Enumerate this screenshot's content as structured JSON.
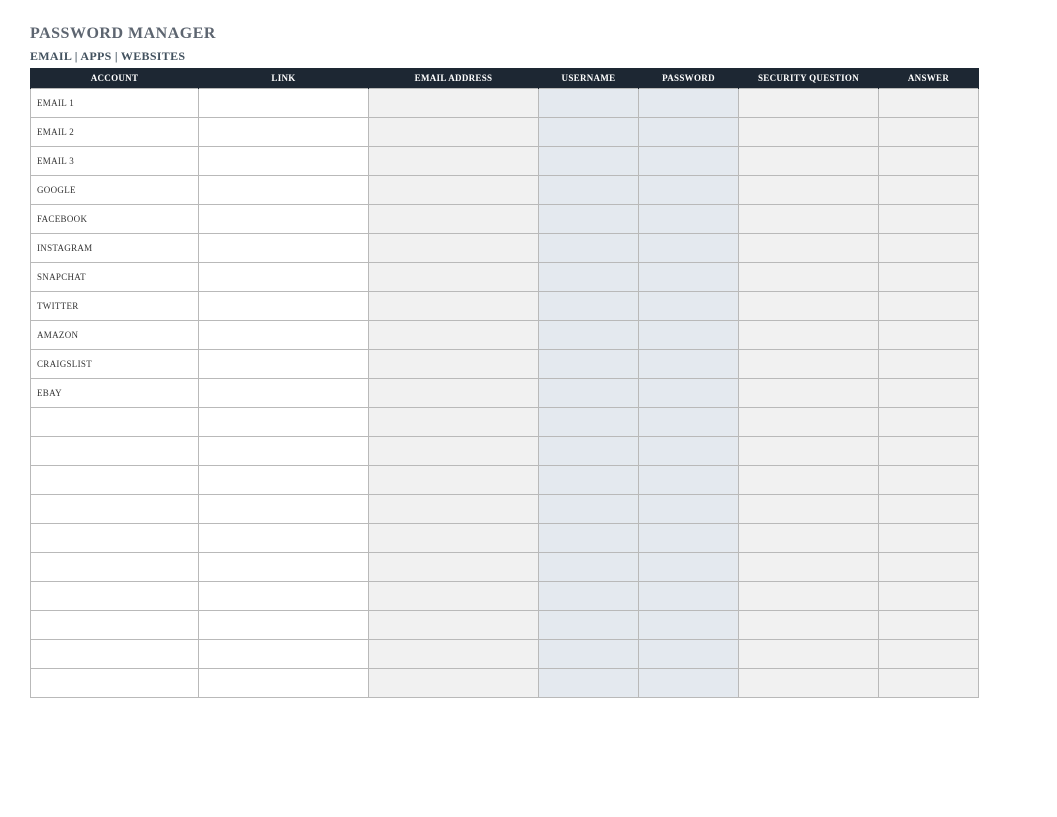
{
  "title": "PASSWORD MANAGER",
  "subtitle": "EMAIL | APPS | WEBSITES",
  "columns": {
    "account": "ACCOUNT",
    "link": "LINK",
    "email": "EMAIL ADDRESS",
    "username": "USERNAME",
    "password": "PASSWORD",
    "secq": "SECURITY QUESTION",
    "answer": "ANSWER"
  },
  "rows": [
    {
      "account": "EMAIL 1",
      "link": "",
      "email": "",
      "username": "",
      "password": "",
      "secq": "",
      "answer": ""
    },
    {
      "account": "EMAIL 2",
      "link": "",
      "email": "",
      "username": "",
      "password": "",
      "secq": "",
      "answer": ""
    },
    {
      "account": "EMAIL 3",
      "link": "",
      "email": "",
      "username": "",
      "password": "",
      "secq": "",
      "answer": ""
    },
    {
      "account": "GOOGLE",
      "link": "",
      "email": "",
      "username": "",
      "password": "",
      "secq": "",
      "answer": ""
    },
    {
      "account": "FACEBOOK",
      "link": "",
      "email": "",
      "username": "",
      "password": "",
      "secq": "",
      "answer": ""
    },
    {
      "account": "INSTAGRAM",
      "link": "",
      "email": "",
      "username": "",
      "password": "",
      "secq": "",
      "answer": ""
    },
    {
      "account": "SNAPCHAT",
      "link": "",
      "email": "",
      "username": "",
      "password": "",
      "secq": "",
      "answer": ""
    },
    {
      "account": "TWITTER",
      "link": "",
      "email": "",
      "username": "",
      "password": "",
      "secq": "",
      "answer": ""
    },
    {
      "account": "AMAZON",
      "link": "",
      "email": "",
      "username": "",
      "password": "",
      "secq": "",
      "answer": ""
    },
    {
      "account": "CRAIGSLIST",
      "link": "",
      "email": "",
      "username": "",
      "password": "",
      "secq": "",
      "answer": ""
    },
    {
      "account": "EBAY",
      "link": "",
      "email": "",
      "username": "",
      "password": "",
      "secq": "",
      "answer": ""
    },
    {
      "account": "",
      "link": "",
      "email": "",
      "username": "",
      "password": "",
      "secq": "",
      "answer": ""
    },
    {
      "account": "",
      "link": "",
      "email": "",
      "username": "",
      "password": "",
      "secq": "",
      "answer": ""
    },
    {
      "account": "",
      "link": "",
      "email": "",
      "username": "",
      "password": "",
      "secq": "",
      "answer": ""
    },
    {
      "account": "",
      "link": "",
      "email": "",
      "username": "",
      "password": "",
      "secq": "",
      "answer": ""
    },
    {
      "account": "",
      "link": "",
      "email": "",
      "username": "",
      "password": "",
      "secq": "",
      "answer": ""
    },
    {
      "account": "",
      "link": "",
      "email": "",
      "username": "",
      "password": "",
      "secq": "",
      "answer": ""
    },
    {
      "account": "",
      "link": "",
      "email": "",
      "username": "",
      "password": "",
      "secq": "",
      "answer": ""
    },
    {
      "account": "",
      "link": "",
      "email": "",
      "username": "",
      "password": "",
      "secq": "",
      "answer": ""
    },
    {
      "account": "",
      "link": "",
      "email": "",
      "username": "",
      "password": "",
      "secq": "",
      "answer": ""
    },
    {
      "account": "",
      "link": "",
      "email": "",
      "username": "",
      "password": "",
      "secq": "",
      "answer": ""
    }
  ]
}
